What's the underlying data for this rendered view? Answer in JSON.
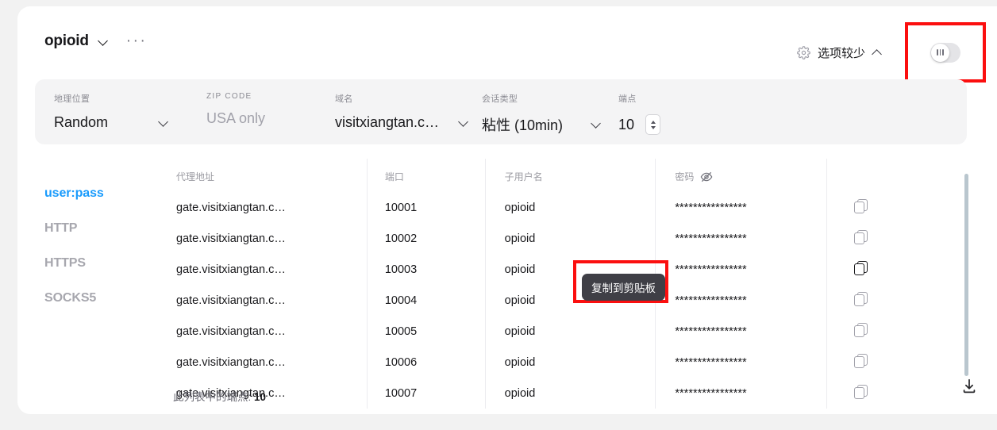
{
  "header": {
    "proxy_name": "opioid",
    "dropdown_icon": "chevron-down-icon",
    "more_menu": "···",
    "options_label": "选项较少",
    "options_gear_icon": "gear-icon",
    "options_collapse_icon": "chevron-up-icon",
    "toggle_state": "off"
  },
  "filters": [
    {
      "label": "地理位置",
      "value": "Random",
      "placeholder": "",
      "control": "select",
      "caps": false
    },
    {
      "label": "ZIP CODE",
      "value": "",
      "placeholder": "USA only",
      "control": "input",
      "caps": true
    },
    {
      "label": "域名",
      "value": "visitxiangtan.c…",
      "placeholder": "",
      "control": "select",
      "caps": false
    },
    {
      "label": "会话类型",
      "value": "粘性 (10min)",
      "placeholder": "",
      "control": "select",
      "caps": false
    },
    {
      "label": "端点",
      "value": "10",
      "placeholder": "",
      "control": "stepper",
      "caps": false
    }
  ],
  "format_tabs": [
    {
      "label": "user:pass",
      "active": true
    },
    {
      "label": "HTTP",
      "active": false
    },
    {
      "label": "HTTPS",
      "active": false
    },
    {
      "label": "SOCKS5",
      "active": false
    }
  ],
  "table": {
    "columns": [
      {
        "key": "address",
        "label": "代理地址"
      },
      {
        "key": "port",
        "label": "端口"
      },
      {
        "key": "username",
        "label": "子用户名"
      },
      {
        "key": "password",
        "label": "密码"
      },
      {
        "key": "copy",
        "label": ""
      }
    ],
    "password_toggle_icon": "eye-slash-icon",
    "copy_icon": "copy-icon",
    "rows": [
      {
        "address": "gate.visitxiangtan.c…",
        "port": "10001",
        "username": "opioid",
        "password": "****************"
      },
      {
        "address": "gate.visitxiangtan.c…",
        "port": "10002",
        "username": "opioid",
        "password": "****************"
      },
      {
        "address": "gate.visitxiangtan.c…",
        "port": "10003",
        "username": "opioid",
        "password": "****************"
      },
      {
        "address": "gate.visitxiangtan.c…",
        "port": "10004",
        "username": "opioid",
        "password": "****************"
      },
      {
        "address": "gate.visitxiangtan.c…",
        "port": "10005",
        "username": "opioid",
        "password": "****************"
      },
      {
        "address": "gate.visitxiangtan.c…",
        "port": "10006",
        "username": "opioid",
        "password": "****************"
      },
      {
        "address": "gate.visitxiangtan.c…",
        "port": "10007",
        "username": "opioid",
        "password": "****************"
      }
    ]
  },
  "tooltip": {
    "text": "复制到剪贴板",
    "highlight_color": "#fb0f0f"
  },
  "footer": {
    "count_label": "此列表中的端点:",
    "count_value": "10",
    "download_icon": "download-icon"
  },
  "colors": {
    "accent": "#1a9bfc",
    "highlight": "#fb0f0f",
    "panel": "#f4f4f5",
    "page_bg": "#f2f2f2"
  }
}
